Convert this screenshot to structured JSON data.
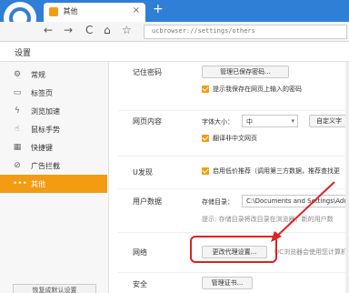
{
  "tab": {
    "title": "其他",
    "close": "×",
    "new": "+"
  },
  "toolbar": {
    "back": "←",
    "forward": "→",
    "refresh": "C",
    "home": "⌂",
    "star": "☆",
    "menu": "⌄",
    "address": "ucbrowser://settings/others"
  },
  "header": {
    "title": "设置"
  },
  "sidebar": {
    "items": [
      {
        "label": "常规",
        "icon": "⚙"
      },
      {
        "label": "标签页",
        "icon": "▭"
      },
      {
        "label": "浏览加速",
        "icon": "ϟ"
      },
      {
        "label": "鼠标手势",
        "icon": "☝"
      },
      {
        "label": "快捷键",
        "icon": "▦"
      },
      {
        "label": "广告拦截",
        "icon": "⊘"
      },
      {
        "label": "其他",
        "icon": "•••"
      }
    ],
    "restore": "恢复成默认设置"
  },
  "password": {
    "label": "记住密码",
    "manage_btn": "管理已保存密码...",
    "prompt_text": "提示我保存在网页上输入的密码"
  },
  "webcontent": {
    "label": "网页内容",
    "fontsize_label": "字体大小：",
    "fontsize_value": "中",
    "custom_btn": "自定义字",
    "translate_text": "翻译非中文网页"
  },
  "ufind": {
    "label": "U发现",
    "text": "启用低价推荐（调用第三方数据，推荐查找更"
  },
  "userdata": {
    "label": "用户数据",
    "dir_label": "存储目录：",
    "dir_value": "C:\\Documents and Settings\\Administ",
    "hint": "提示: 存储目录将改目录在浏览器，新的用户数"
  },
  "network": {
    "label": "网络",
    "proxy_btn": "更改代理设置...",
    "hint": "UC浏览器会使用您计算机"
  },
  "security": {
    "label": "安全",
    "cert_btn": "管理证书..."
  }
}
